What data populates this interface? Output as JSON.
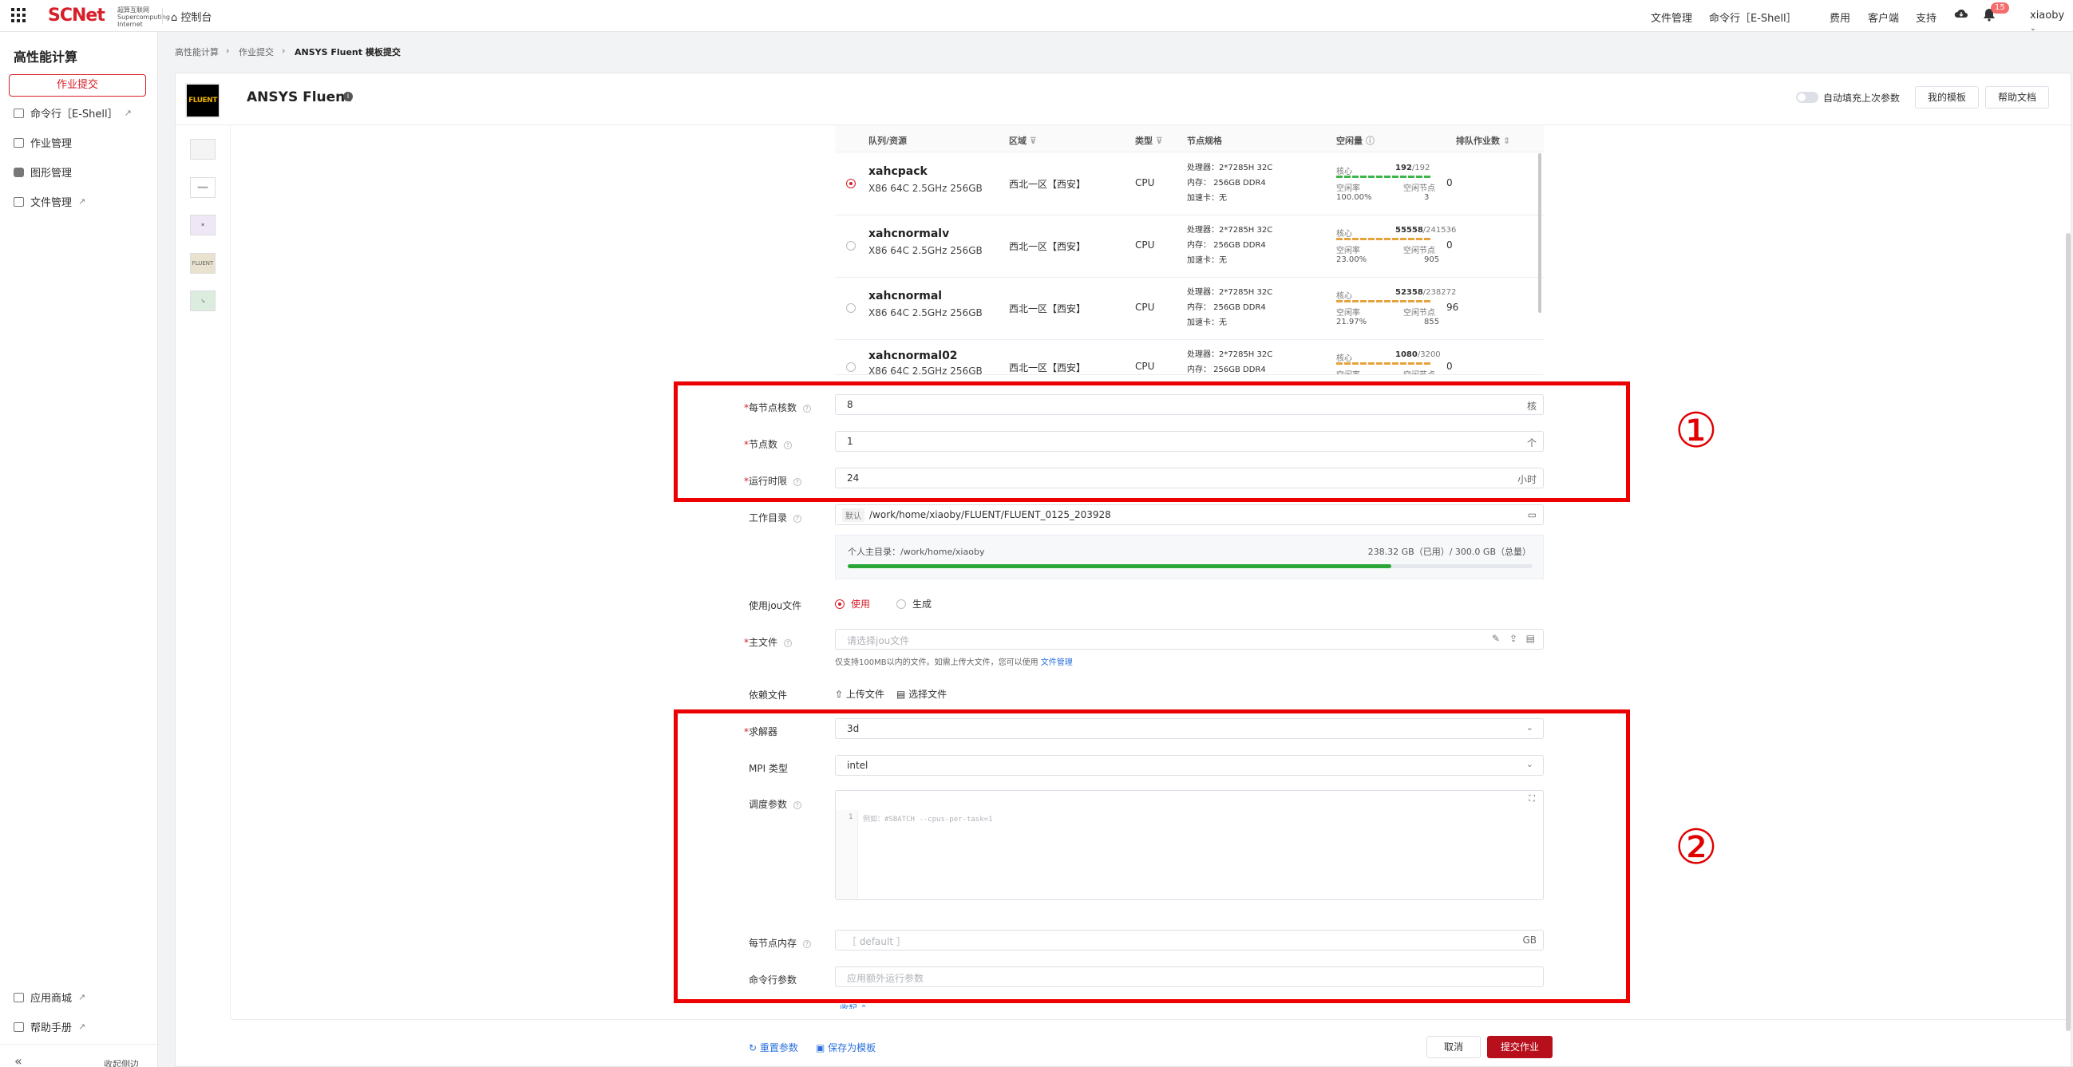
{
  "topbar": {
    "brand": "SCNet",
    "brand_sub": "超算互联网 Supercomputing Internet",
    "console": "控制台",
    "nav": [
      "文件管理",
      "命令行［E-Shell］",
      "费用",
      "客户端",
      "支持"
    ],
    "bell_count": "15",
    "user": "xiaoby"
  },
  "sidebar": {
    "title": "高性能计算",
    "submit": "作业提交",
    "items": [
      {
        "label": "命令行［E-Shell］",
        "external": true
      },
      {
        "label": "作业管理",
        "external": false
      },
      {
        "label": "图形管理",
        "external": false
      },
      {
        "label": "文件管理",
        "external": true
      }
    ],
    "bottom_items": [
      {
        "label": "应用商城",
        "external": true
      },
      {
        "label": "帮助手册",
        "external": true
      }
    ],
    "collapse": "收起侧边"
  },
  "breadcrumb": [
    "高性能计算",
    "作业提交",
    "ANSYS Fluent 模板提交"
  ],
  "header": {
    "logo_text": "FLUENT",
    "title": "ANSYS Fluent",
    "autofill": "自动填充上次参数",
    "my_template": "我的模板",
    "help_doc": "帮助文档"
  },
  "queue_table": {
    "headers": [
      "队列/资源",
      "区域",
      "类型",
      "节点规格",
      "空闲量",
      "排队作业数"
    ],
    "rows": [
      {
        "name": "xahcpack",
        "spec": "X86 64C 2.5GHz 256GB",
        "region": "西北一区【西安】",
        "type": "CPU",
        "cpu": "处理器：2*7285H 32C",
        "mem": "内存： 256GB DDR4",
        "acc": "加速卡：无",
        "core_used": "192",
        "core_total": "/192",
        "idle_rate": "100.00%",
        "idle_nodes": "3",
        "waiting": "0",
        "selected": true,
        "bar_color": "#3cb54a"
      },
      {
        "name": "xahcnormalv",
        "spec": "X86 64C 2.5GHz 256GB",
        "region": "西北一区【西安】",
        "type": "CPU",
        "cpu": "处理器：2*7285H 32C",
        "mem": "内存： 256GB DDR4",
        "acc": "加速卡：无",
        "core_used": "55558",
        "core_total": "/241536",
        "idle_rate": "23.00%",
        "idle_nodes": "905",
        "waiting": "0",
        "selected": false,
        "bar_color": "#e6a23c"
      },
      {
        "name": "xahcnormal",
        "spec": "X86 64C 2.5GHz 256GB",
        "region": "西北一区【西安】",
        "type": "CPU",
        "cpu": "处理器：2*7285H 32C",
        "mem": "内存： 256GB DDR4",
        "acc": "加速卡：无",
        "core_used": "52358",
        "core_total": "/238272",
        "idle_rate": "21.97%",
        "idle_nodes": "855",
        "waiting": "96",
        "selected": false,
        "bar_color": "#e6a23c"
      },
      {
        "name": "xahcnormal02",
        "spec": "X86 64C 2.5GHz 256GB",
        "region": "西北一区【西安】",
        "type": "CPU",
        "cpu": "处理器：2*7285H 32C",
        "mem": "内存： 256GB DDR4",
        "acc": "",
        "core_used": "1080",
        "core_total": "/3200",
        "idle_rate": "",
        "idle_nodes": "",
        "waiting": "0",
        "selected": false,
        "bar_color": "#e6a23c"
      }
    ],
    "res_labels": {
      "core": "核心",
      "idle_rate": "空闲率",
      "idle_nodes": "空闲节点"
    }
  },
  "form": {
    "cores_per_node": {
      "label": "每节点核数",
      "value": "8",
      "unit": "核"
    },
    "nodes": {
      "label": "节点数",
      "value": "1",
      "unit": "个"
    },
    "walltime": {
      "label": "运行时限",
      "value": "24",
      "unit": "小时"
    },
    "workdir": {
      "label": "工作目录",
      "tag": "默认",
      "value": "/work/home/xiaoby/FLUENT/FLUENT_0125_203928"
    },
    "home_dir": {
      "label": "个人主目录：/work/home/xiaoby",
      "usage": "238.32 GB（已用）/ 300.0 GB（总量）",
      "fraction": 0.794
    },
    "jou": {
      "label": "使用jou文件",
      "options": [
        "使用",
        "生成"
      ]
    },
    "main_file": {
      "label": "主文件",
      "placeholder": "请选择jou文件",
      "hint": "仅支持100MB以内的文件。如需上传大文件，您可以使用",
      "hint_link": "文件管理"
    },
    "deps": {
      "label": "依赖文件",
      "upload": "上传文件",
      "choose": "选择文件"
    },
    "solver": {
      "label": "求解器",
      "value": "3d"
    },
    "mpi": {
      "label": "MPI 类型",
      "value": "intel"
    },
    "sched": {
      "label": "调度参数",
      "line_no": "1",
      "placeholder": "例如：#SBATCH --cpus-per-task=1"
    },
    "mem": {
      "label": "每节点内存",
      "placeholder": "［ default ］",
      "unit": "GB"
    },
    "cmd": {
      "label": "命令行参数",
      "placeholder": "应用额外运行参数"
    },
    "collapse": "收起"
  },
  "annotations": [
    "①",
    "②"
  ],
  "footer": {
    "reset": "重置参数",
    "save": "保存为模板",
    "cancel": "取消",
    "submit": "提交作业"
  },
  "colors": {
    "brand": "#d81e28",
    "submit": "#b80f1c",
    "annotation": "#ec0000",
    "usage_bar": "#2ba639",
    "link": "#2a6fdb"
  }
}
